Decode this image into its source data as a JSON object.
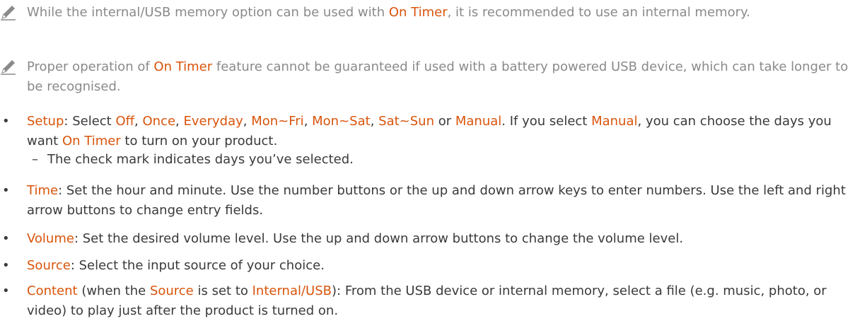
{
  "colors": {
    "highlight": "#d9540b",
    "note_text": "#8a8a8a",
    "body_text": "#3a3a3a"
  },
  "notes": [
    {
      "icon": "pencil-icon",
      "p1": "While the internal/USB memory option can be used with ",
      "h1": "On Timer",
      "p2": ", it is recommended to use an internal memory."
    },
    {
      "icon": "pencil-icon",
      "p1": "Proper operation of ",
      "h1": "On Timer",
      "p2": " feature cannot be guaranteed if used with a battery powered USB device, which can take longer to be recognised."
    }
  ],
  "bullet_glyph": "•",
  "dash_glyph": "–",
  "setup": {
    "term": "Setup",
    "t0": ": Select ",
    "off": "Off",
    "c1": ", ",
    "once": "Once",
    "c2": ", ",
    "everyday": "Everyday",
    "c3": ", ",
    "monfri": "Mon~Fri",
    "c4": ", ",
    "monsat": "Mon~Sat",
    "c5": ", ",
    "satsun": "Sat~Sun",
    "or": " or ",
    "manual": "Manual",
    "t1": ". If you select ",
    "manual2": "Manual",
    "t2": ", you can choose the days you want ",
    "ontimer": "On Timer",
    "t3": " to turn on your product.",
    "sub": "The check mark indicates days you’ve selected."
  },
  "time": {
    "term": "Time",
    "text": ": Set the hour and minute. Use the number buttons or the up and down arrow keys to enter numbers. Use the left and right arrow buttons to change entry fields."
  },
  "volume": {
    "term": "Volume",
    "text": ": Set the desired volume level. Use the up and down arrow buttons to change the volume level."
  },
  "source": {
    "term": "Source",
    "text": ": Select the input source of your choice."
  },
  "content": {
    "term": "Content",
    "t0": " (when the ",
    "source": "Source",
    "t1": " is set to ",
    "internal": "Internal/USB",
    "t2": "): From the USB device or internal memory, select a file (e.g. music, photo, or video) to play just after the product is turned on."
  }
}
